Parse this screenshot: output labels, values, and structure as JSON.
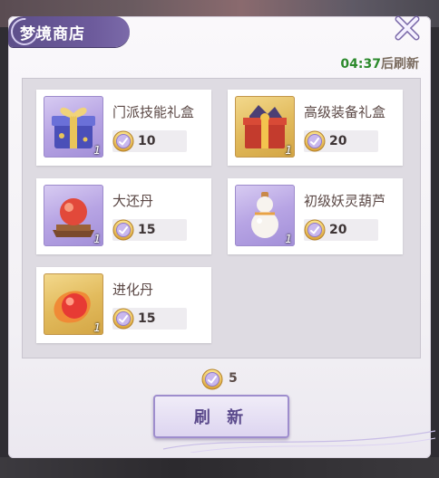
{
  "shop": {
    "title": "梦境商店",
    "refresh_timer": "04:37",
    "refresh_suffix": "后刷新",
    "currency_count": "5",
    "refresh_button": "刷 新",
    "items": [
      {
        "name": "门派技能礼盒",
        "price": "10",
        "qty": "1",
        "icon": "skill-gift-box-icon",
        "frame": "purple"
      },
      {
        "name": "高级装备礼盒",
        "price": "20",
        "qty": "1",
        "icon": "equipment-gift-box-icon",
        "frame": "gold"
      },
      {
        "name": "大还丹",
        "price": "15",
        "qty": "1",
        "icon": "red-pill-icon",
        "frame": "purple"
      },
      {
        "name": "初级妖灵葫芦",
        "price": "20",
        "qty": "1",
        "icon": "gourd-icon",
        "frame": "purple"
      },
      {
        "name": "进化丹",
        "price": "15",
        "qty": "1",
        "icon": "evolution-pill-icon",
        "frame": "gold"
      }
    ]
  },
  "colors": {
    "title_bg": "#6d5b9c",
    "timer_green": "#2c8a2c",
    "button_text": "#5b4a8c"
  }
}
